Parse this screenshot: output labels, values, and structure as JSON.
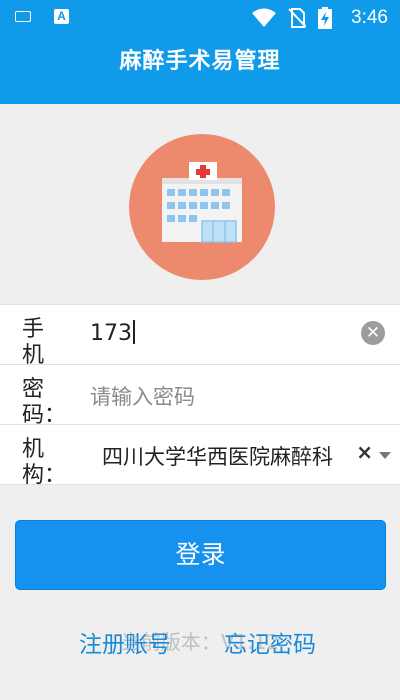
{
  "status_bar": {
    "time": "3:46",
    "icons": [
      "keyboard-icon",
      "a-notification-icon",
      "wifi-icon",
      "no-sim-icon",
      "battery-charging-icon"
    ],
    "a_icon_text": "A"
  },
  "header": {
    "title": "麻醉手术易管理"
  },
  "logo": {
    "icon": "hospital-icon"
  },
  "form": {
    "phone": {
      "label": "手机号：",
      "value": "173"
    },
    "password": {
      "label": "密码：",
      "placeholder": "请输入密码"
    },
    "institution": {
      "label": "机构：",
      "value": "四川大学华西医院麻醉科",
      "clear": "×"
    }
  },
  "login_button": {
    "label": "登录"
  },
  "footer": {
    "register": "注册账号",
    "forgot": "忘记密码",
    "version": "当前版本：V1.12"
  },
  "colors": {
    "primary": "#0f9aea",
    "button": "#1592f0",
    "logo_bg": "#ed8a6d",
    "link": "#1a8ad8"
  }
}
